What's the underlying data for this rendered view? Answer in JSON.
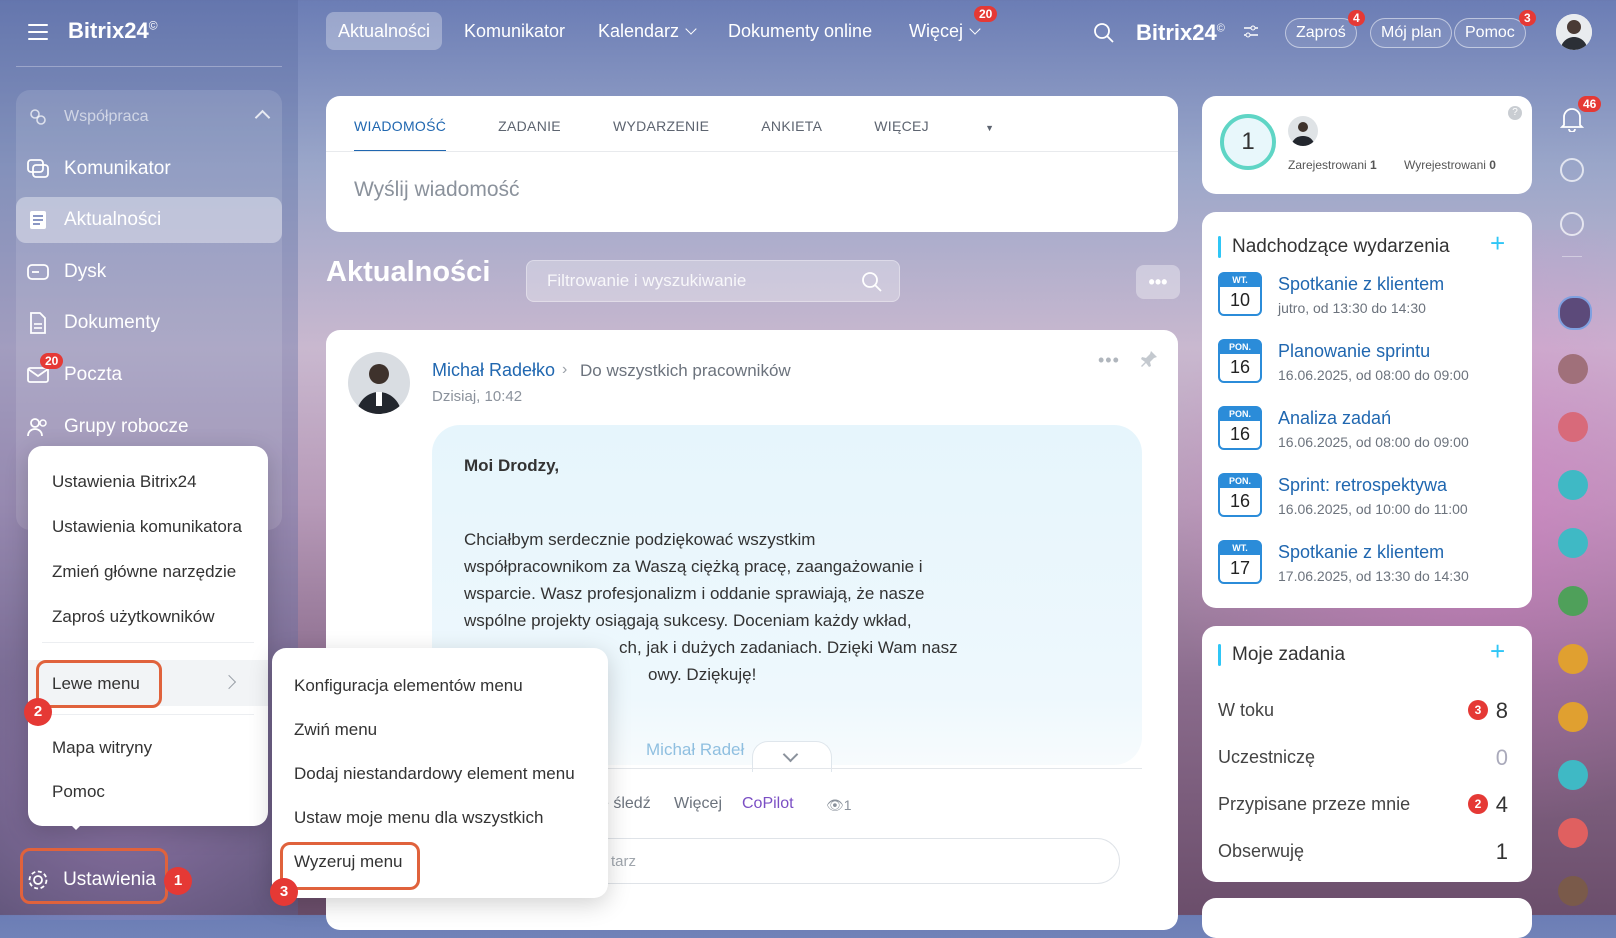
{
  "brand": "Bitrix24",
  "brand_mark": "©",
  "topnav": {
    "items": [
      "Aktualności",
      "Komunikator",
      "Kalendarz",
      "Dokumenty online",
      "Więcej"
    ],
    "more_badge": "20",
    "brand_right": "Bitrix24",
    "invite": "Zaproś",
    "invite_badge": "4",
    "my_plan": "Mój plan",
    "help": "Pomoc",
    "help_badge": "3"
  },
  "sidebar": {
    "group": "Współpraca",
    "items": [
      "Komunikator",
      "Aktualności",
      "Dysk",
      "Dokumenty",
      "Poczta",
      "Grupy robocze"
    ],
    "mail_badge": "20",
    "settings": "Ustawienia"
  },
  "composer": {
    "tabs": [
      "WIADOMOŚĆ",
      "ZADANIE",
      "WYDARZENIE",
      "ANKIETA",
      "WIĘCEJ"
    ],
    "placeholder": "Wyślij wiadomość"
  },
  "feed": {
    "title": "Aktualności",
    "filter_placeholder": "Filtrowanie i wyszukiwanie",
    "more": "•••"
  },
  "post": {
    "author": "Michał Radełko",
    "recipient": "Do wszystkich pracowników",
    "time": "Dzisiaj, 10:42",
    "greeting": "Moi Drodzy,",
    "lines": [
      "Chciałbym serdecznie podziękować wszystkim",
      "współpracownikom za Waszą ciężką pracę, zaangażowanie i",
      "wsparcie. Wasz profesjonalizm i oddanie sprawiają, że nasze",
      "wspólne projekty osiągają sukcesy. Doceniam każdy wkład,",
      "ch, jak i dużych zadaniach. Dzięki Wam nasz",
      "owy. Dziękuję!"
    ],
    "footer_author": "Michał Radeł",
    "actions": [
      "e śledź",
      "Więcej",
      "CoPilot"
    ],
    "views": "1",
    "comment_placeholder": "tarz"
  },
  "presence": {
    "count": "1",
    "registered_label": "Zarejestrowani",
    "registered": "1",
    "unregistered_label": "Wyrejestrowani",
    "unregistered": "0",
    "help": "?"
  },
  "notifications_badge": "46",
  "events": {
    "title": "Nadchodzące wydarzenia",
    "items": [
      {
        "day": "WT.",
        "num": "10",
        "title": "Spotkanie z klientem",
        "sub": "jutro, od 13:30 do 14:30"
      },
      {
        "day": "PON.",
        "num": "16",
        "title": "Planowanie sprintu",
        "sub": "16.06.2025, od 08:00 do 09:00"
      },
      {
        "day": "PON.",
        "num": "16",
        "title": "Analiza zadań",
        "sub": "16.06.2025, od 08:00 do 09:00"
      },
      {
        "day": "PON.",
        "num": "16",
        "title": "Sprint: retrospektywa",
        "sub": "16.06.2025, od 10:00 do 11:00"
      },
      {
        "day": "WT.",
        "num": "17",
        "title": "Spotkanie z klientem",
        "sub": "17.06.2025, od 13:30 do 14:30"
      }
    ]
  },
  "tasks": {
    "title": "Moje zadania",
    "rows": [
      {
        "label": "W toku",
        "badge": "3",
        "count": "8"
      },
      {
        "label": "Uczestniczę",
        "badge": "",
        "count": "0"
      },
      {
        "label": "Przypisane przeze mnie",
        "badge": "2",
        "count": "4"
      },
      {
        "label": "Obserwuję",
        "badge": "",
        "count": "1"
      }
    ]
  },
  "settings_menu": {
    "items": [
      "Ustawienia Bitrix24",
      "Ustawienia komunikatora",
      "Zmień główne narzędzie",
      "Zaproś użytkowników",
      "Lewe menu",
      "Mapa witryny",
      "Pomoc"
    ]
  },
  "left_menu_submenu": {
    "items": [
      "Konfiguracja elementów menu",
      "Zwiń menu",
      "Dodaj niestandardowy element menu",
      "Ustaw moje menu dla wszystkich",
      "Wyzeruj menu"
    ]
  },
  "steps": [
    "1",
    "2",
    "3"
  ],
  "colors": {
    "accent": "#2067b0",
    "highlight": "#e0623c",
    "badge": "#e53935",
    "tab_active": "#2067b0"
  }
}
